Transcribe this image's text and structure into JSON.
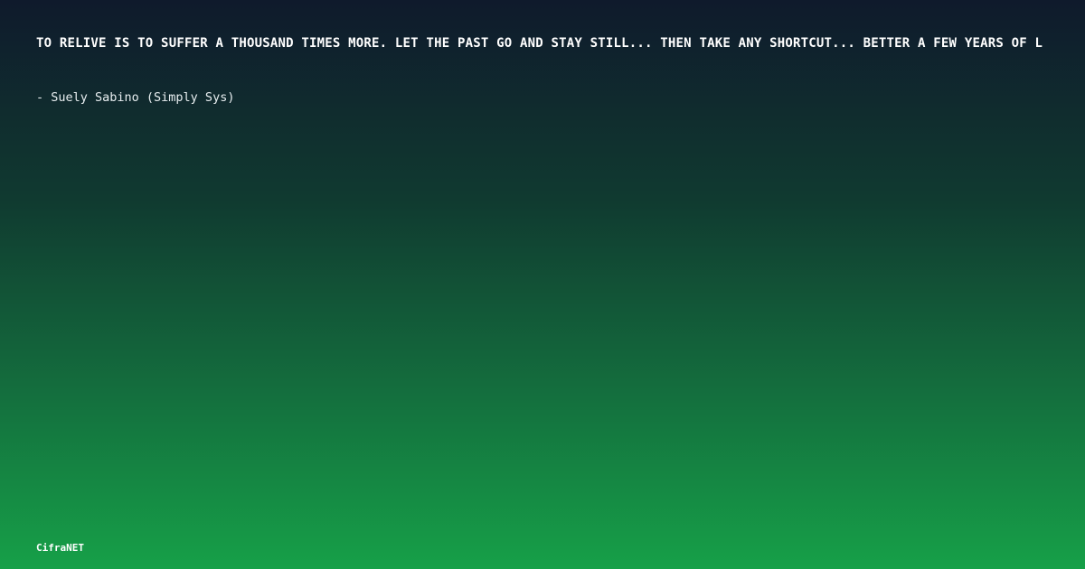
{
  "quote": {
    "text": "TO RELIVE IS TO SUFFER A THOUSAND TIMES MORE. LET THE PAST GO AND STAY STILL... THEN TAKE ANY SHORTCUT... BETTER A FEW YEARS OF L"
  },
  "author": {
    "text": "- Suely Sabino (Simply Sys)"
  },
  "brand": {
    "name": "CifraNET"
  },
  "colors": {
    "gradient_top": "#0f1a2c",
    "gradient_bottom": "#16a048",
    "text": "#ffffff"
  }
}
